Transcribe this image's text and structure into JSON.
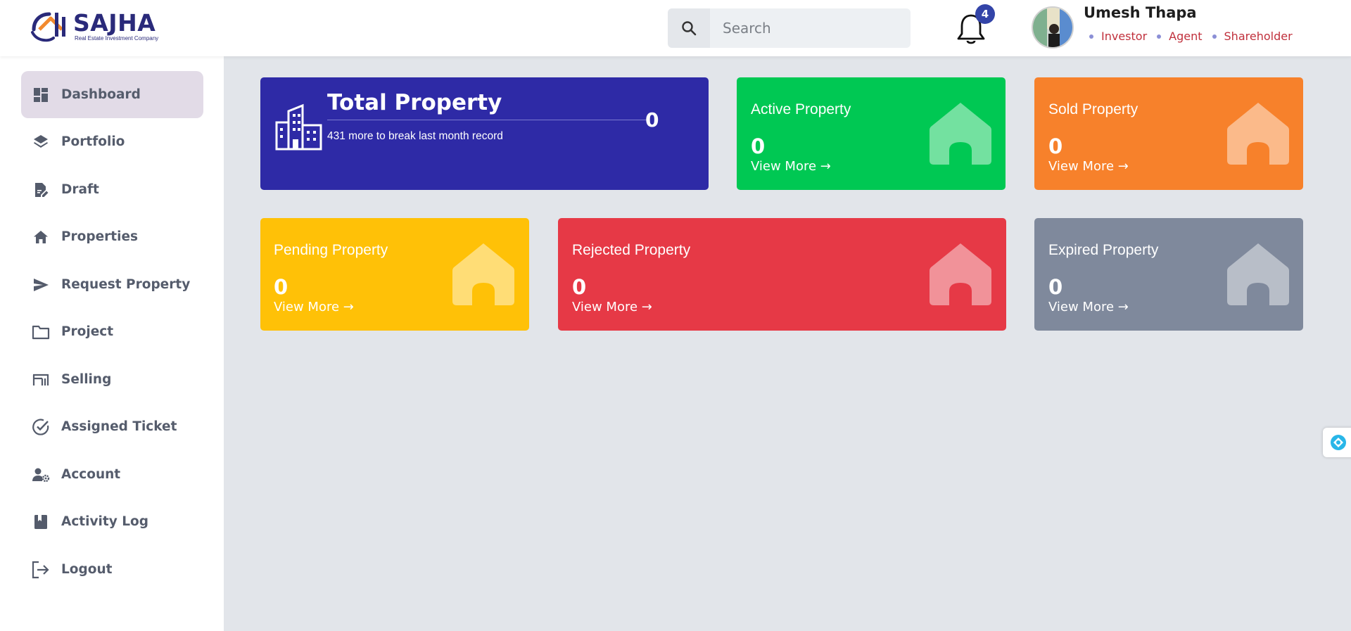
{
  "brand": {
    "name": "SAJHA",
    "tagline": "Real Estate Investment Company"
  },
  "search": {
    "placeholder": "Search",
    "icon": "search-icon"
  },
  "notifications": {
    "count": "4",
    "icon": "bell-icon"
  },
  "user": {
    "name": "Umesh Thapa",
    "roles": [
      "Investor",
      "Agent",
      "Shareholder"
    ]
  },
  "sidebar": {
    "items": [
      {
        "label": "Dashboard",
        "icon": "dashboard-icon",
        "active": true
      },
      {
        "label": "Portfolio",
        "icon": "layers-icon"
      },
      {
        "label": "Draft",
        "icon": "document-edit-icon"
      },
      {
        "label": "Properties",
        "icon": "home-icon"
      },
      {
        "label": "Request Property",
        "icon": "send-icon"
      },
      {
        "label": "Project",
        "icon": "folder-icon"
      },
      {
        "label": "Selling",
        "icon": "storefront-icon"
      },
      {
        "label": "Assigned Ticket",
        "icon": "check-circle-icon"
      },
      {
        "label": "Account",
        "icon": "user-settings-icon"
      },
      {
        "label": "Activity Log",
        "icon": "bookmark-book-icon"
      },
      {
        "label": "Logout",
        "icon": "logout-icon"
      }
    ]
  },
  "total_property": {
    "title": "Total Property",
    "subtitle": "431 more to break last month record",
    "value": "0",
    "icon": "buildings-icon"
  },
  "cards": {
    "active": {
      "title": "Active Property",
      "value": "0",
      "link": "View More →",
      "color": "#00c853"
    },
    "sold": {
      "title": "Sold Property",
      "value": "0",
      "link": "View More →",
      "color": "#f7812b"
    },
    "pending": {
      "title": "Pending Property",
      "value": "0",
      "link": "View More →",
      "color": "#ffc107"
    },
    "rejected": {
      "title": "Rejected Property",
      "value": "0",
      "link": "View More →",
      "color": "#e63946"
    },
    "expired": {
      "title": "Expired Property",
      "value": "0",
      "link": "View More →",
      "color": "#7f899c"
    }
  },
  "colors": {
    "total_card": "#2e2aa6",
    "sidebar_active": "#e2dbe7",
    "role_text": "#c0303c",
    "badge": "#3344a8"
  }
}
